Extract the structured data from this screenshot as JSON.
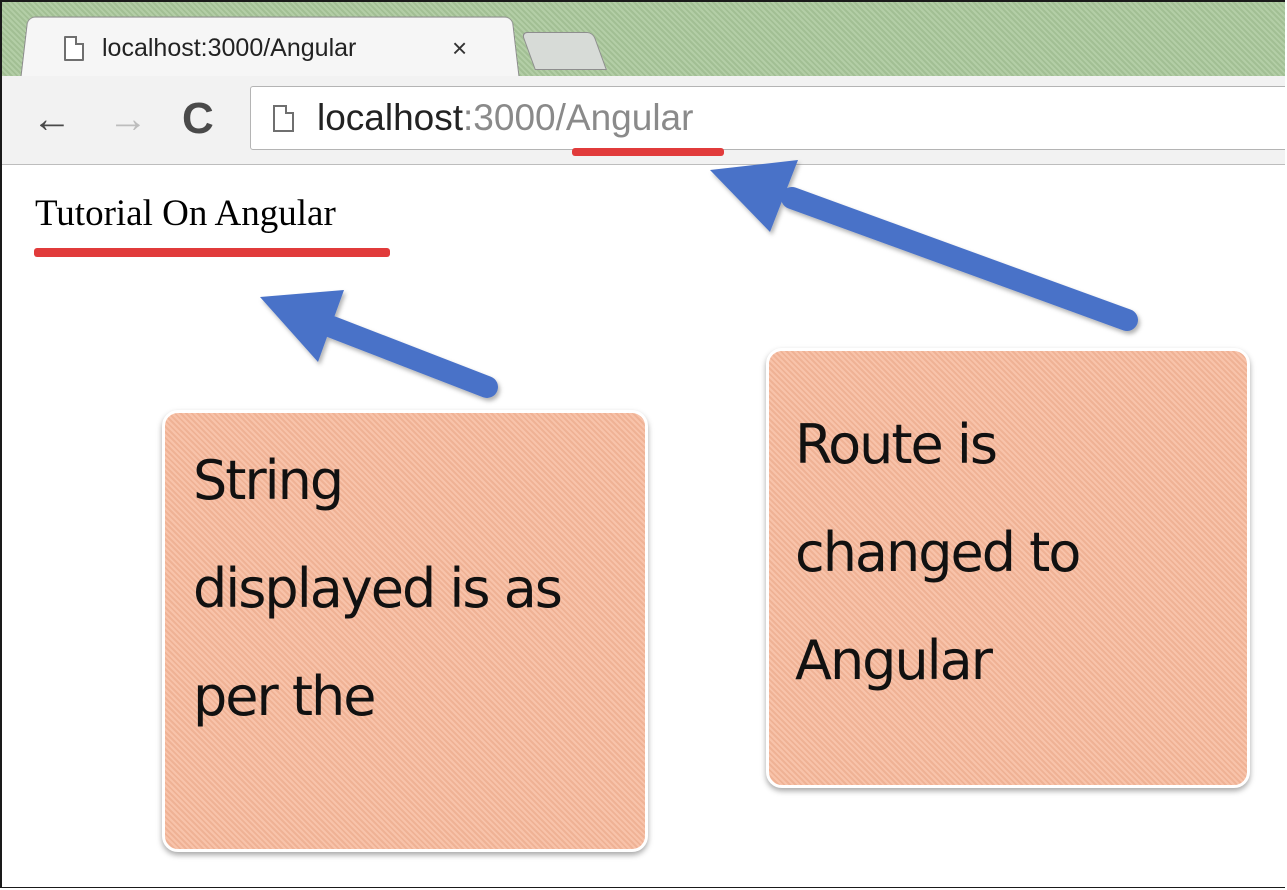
{
  "browser": {
    "tab": {
      "title": "localhost:3000/Angular",
      "close_glyph": "×"
    },
    "toolbar": {
      "back_glyph": "←",
      "forward_glyph": "→",
      "reload_glyph": "C"
    },
    "address_bar": {
      "host": "localhost",
      "port": ":3000",
      "path": "/Angular"
    }
  },
  "page": {
    "heading": "Tutorial On Angular"
  },
  "annotations": {
    "left_note": "String\ndisplayed is as\nper the",
    "right_note": "Route is\nchanged to\nAngular"
  },
  "colors": {
    "underline": "#e13b3b",
    "arrow": "#4a72c8",
    "note_fill": "#f7b89a",
    "tabstrip": "#a9c79a"
  },
  "icons": {
    "tab_favicon": "page-icon",
    "omnibox_favicon": "page-icon"
  }
}
